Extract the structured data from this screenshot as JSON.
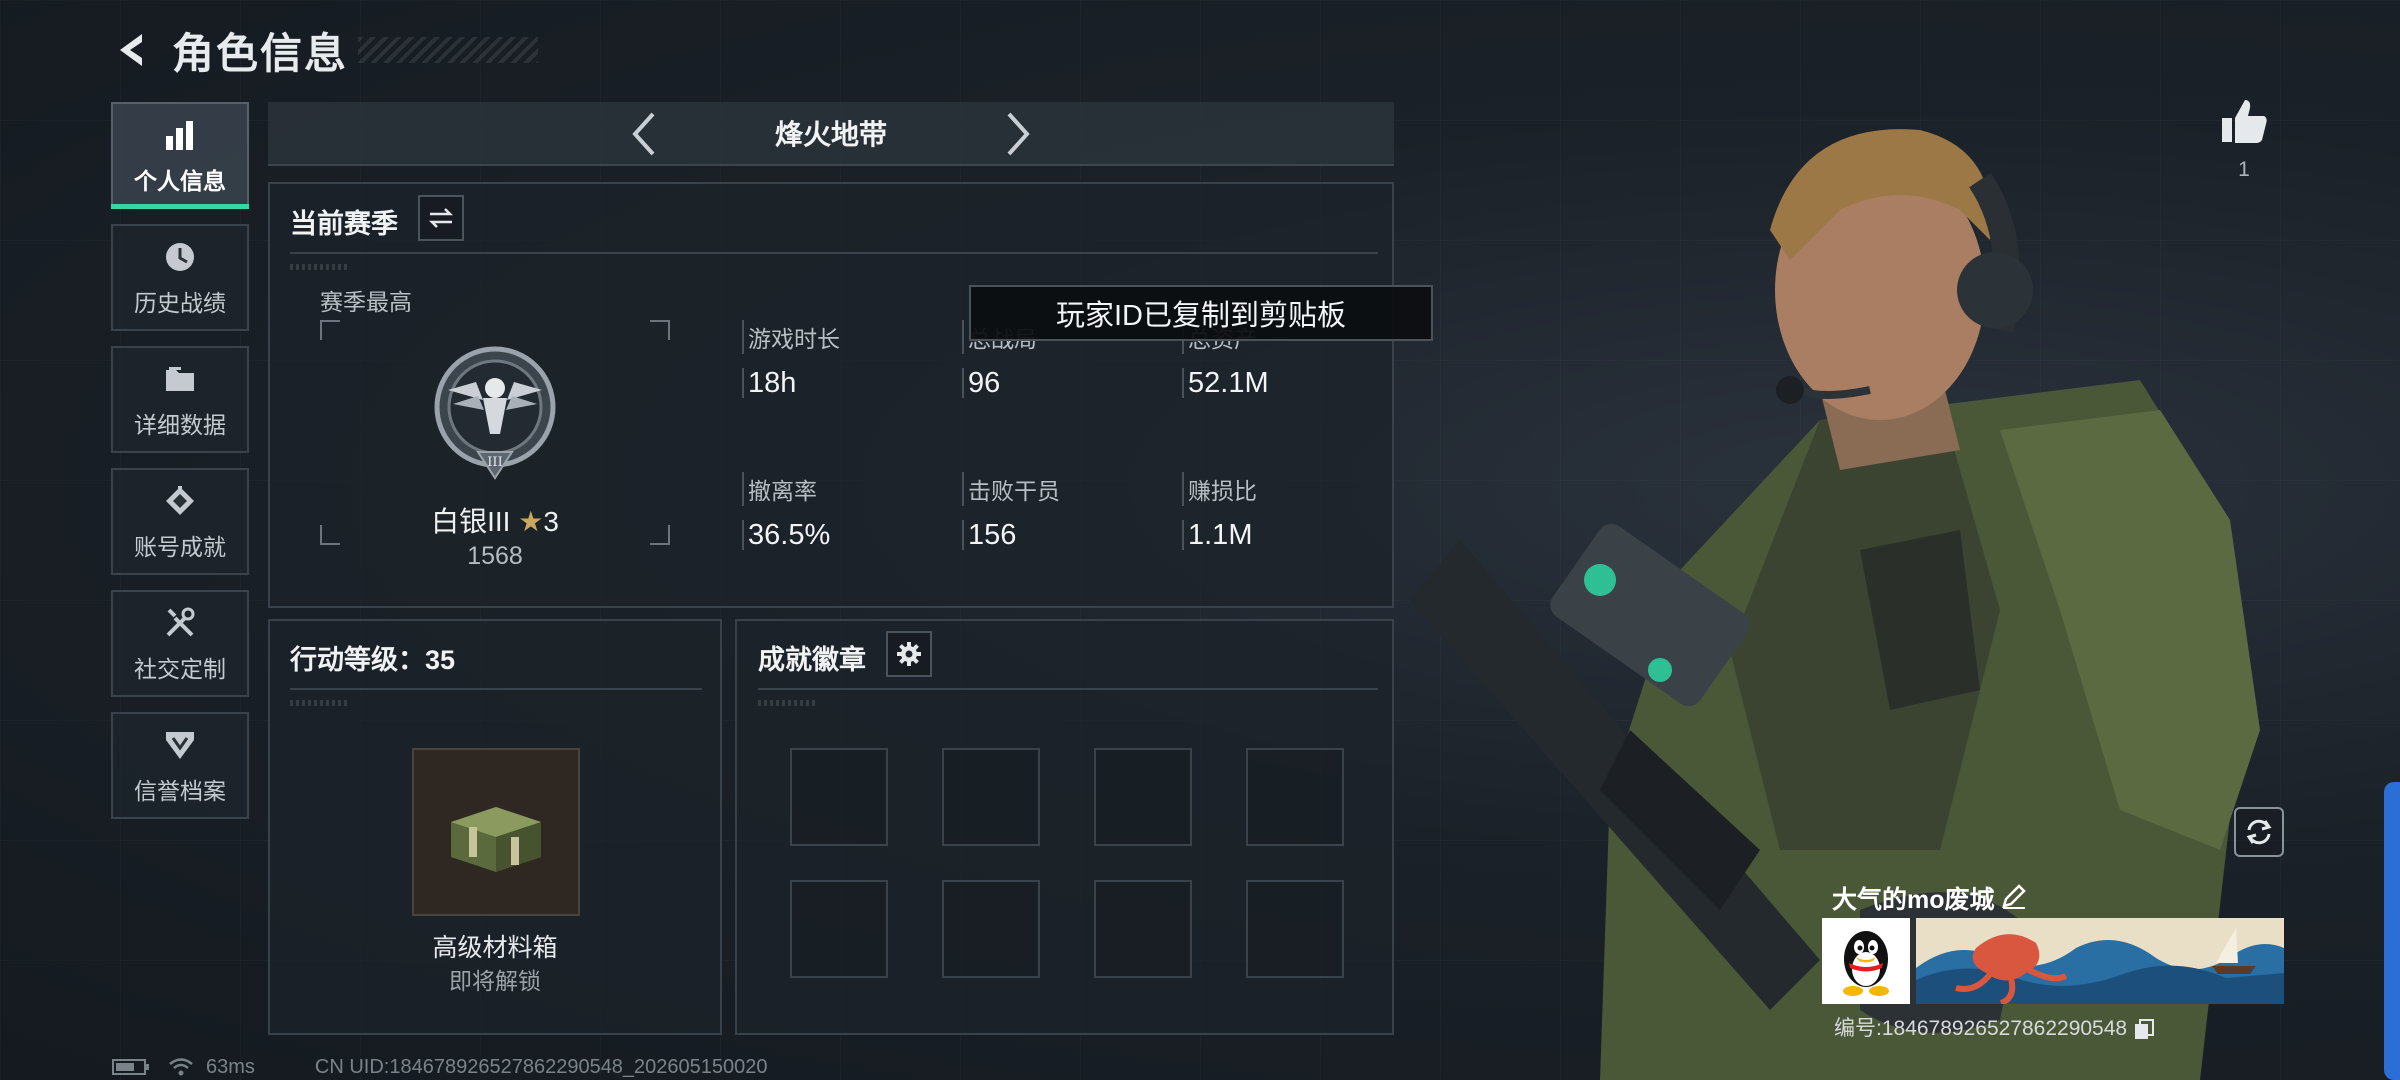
{
  "header": {
    "title": "角色信息",
    "back_icon": "back-arrow-icon"
  },
  "sidebar": {
    "items": [
      {
        "label": "个人信息",
        "icon": "bar-chart-icon",
        "active": true
      },
      {
        "label": "历史战绩",
        "icon": "history-clock-icon",
        "active": false
      },
      {
        "label": "详细数据",
        "icon": "folder-icon",
        "active": false
      },
      {
        "label": "账号成就",
        "icon": "achievement-icon",
        "active": false
      },
      {
        "label": "社交定制",
        "icon": "tools-icon",
        "active": false
      },
      {
        "label": "信誉档案",
        "icon": "reputation-shield-icon",
        "active": false
      }
    ]
  },
  "mode": {
    "name": "烽火地带"
  },
  "season": {
    "title": "当前赛季",
    "best_label": "赛季最高",
    "rank_name": "白银III",
    "rank_stars": "3",
    "rank_score": "1568",
    "stats": [
      {
        "label": "游戏时长",
        "value": "18h"
      },
      {
        "label": "总战局",
        "value": "96"
      },
      {
        "label": "总资产",
        "value": "52.1M"
      },
      {
        "label": "撤离率",
        "value": "36.5%"
      },
      {
        "label": "击败干员",
        "value": "156"
      },
      {
        "label": "赚损比",
        "value": "1.1M"
      }
    ]
  },
  "toast": {
    "text": "玩家ID已复制到剪贴板"
  },
  "action_level": {
    "title": "行动等级：35",
    "reward_name": "高级材料箱",
    "reward_status": "即将解锁"
  },
  "badges": {
    "title": "成就徽章",
    "slots": 8
  },
  "like": {
    "count": "1"
  },
  "player": {
    "name": "大气的mo废城",
    "id_text": "编号:1846789265278622905​48"
  },
  "statusbar": {
    "ping": "63ms",
    "uid": "CN UID:1846789265278622905​48_202605150020"
  },
  "colors": {
    "accent": "#37d7a4",
    "panel_border": "#39424b",
    "blue_tab": "#2b6fd6"
  }
}
